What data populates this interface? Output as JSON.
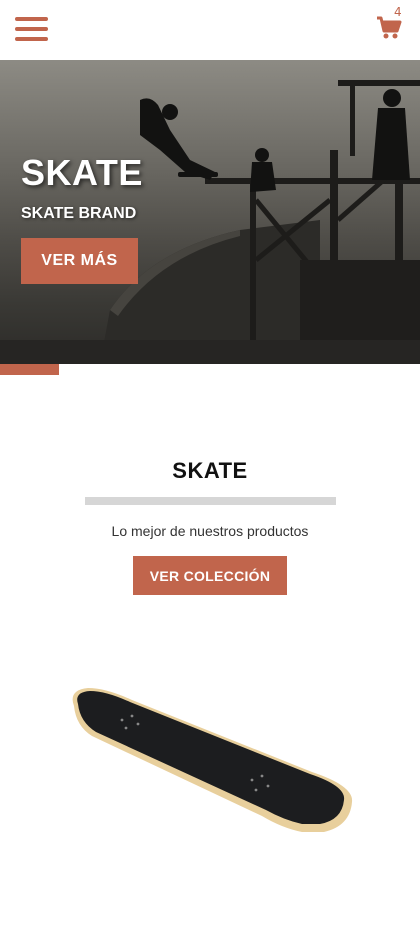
{
  "header": {
    "menu_icon": "hamburger-menu-icon",
    "cart_icon": "shopping-cart-icon",
    "cart_count": "4"
  },
  "hero": {
    "title": "SKATE",
    "subtitle": "SKATE BRAND",
    "button_label": "VER MÁS"
  },
  "section": {
    "title": "SKATE",
    "tagline": "Lo mejor de nuestros productos",
    "button_label": "VER COLECCIÓN"
  },
  "colors": {
    "accent": "#c1654c",
    "divider": "#d6d6d6",
    "text_dark": "#111111"
  }
}
